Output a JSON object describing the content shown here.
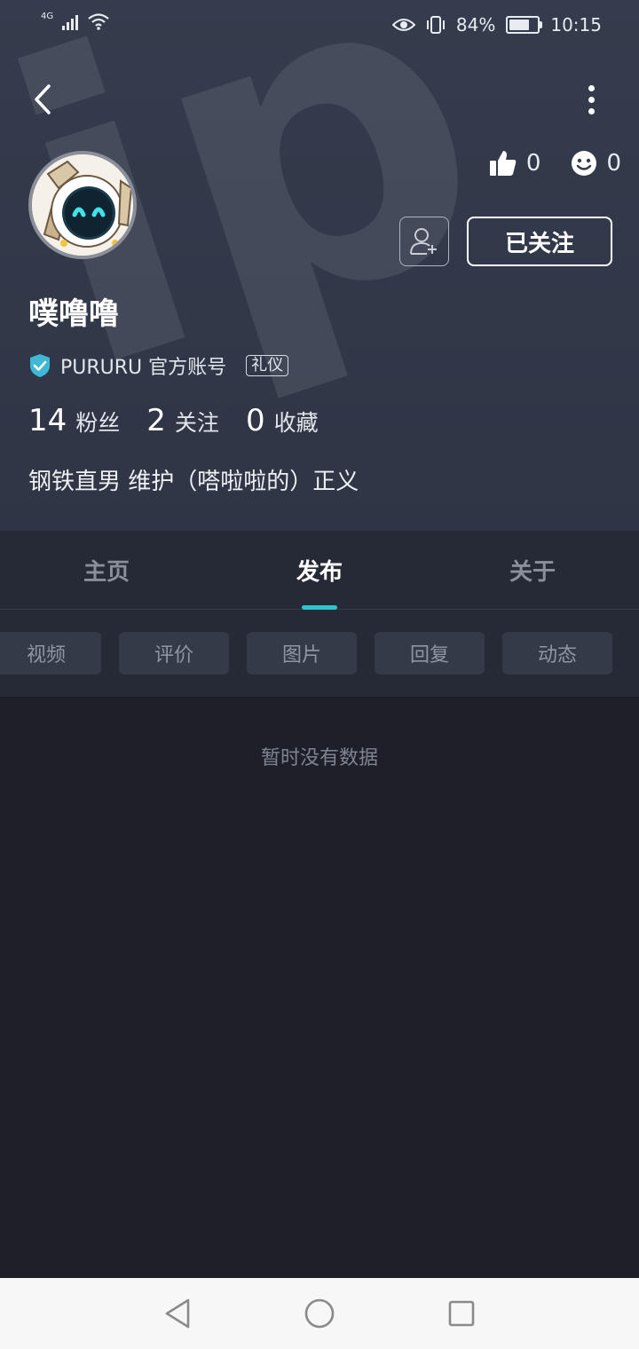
{
  "status_bar": {
    "network": "4G",
    "battery": "84%",
    "time": "10:15"
  },
  "profile": {
    "username": "噗噜噜",
    "verified_label": "PURURU 官方账号",
    "tag": "礼仪",
    "likes": "0",
    "reactions": "0",
    "follow_button": "已关注",
    "bio": "钢铁直男 维护（嗒啦啦的）正义",
    "followers": {
      "value": "14",
      "label": "粉丝"
    },
    "following": {
      "value": "2",
      "label": "关注"
    },
    "favorites": {
      "value": "0",
      "label": "收藏"
    }
  },
  "tabs": [
    {
      "label": "主页"
    },
    {
      "label": "发布"
    },
    {
      "label": "关于"
    }
  ],
  "active_tab": "发布",
  "filters": [
    {
      "label": "视频"
    },
    {
      "label": "评价"
    },
    {
      "label": "图片"
    },
    {
      "label": "回复"
    },
    {
      "label": "动态"
    }
  ],
  "empty_message": "暂时没有数据",
  "colors": {
    "header_bg": "#343c4d",
    "page_bg": "#1f1f29",
    "accent": "#2ec5cf",
    "verified_badge": "#3fb8d6"
  }
}
